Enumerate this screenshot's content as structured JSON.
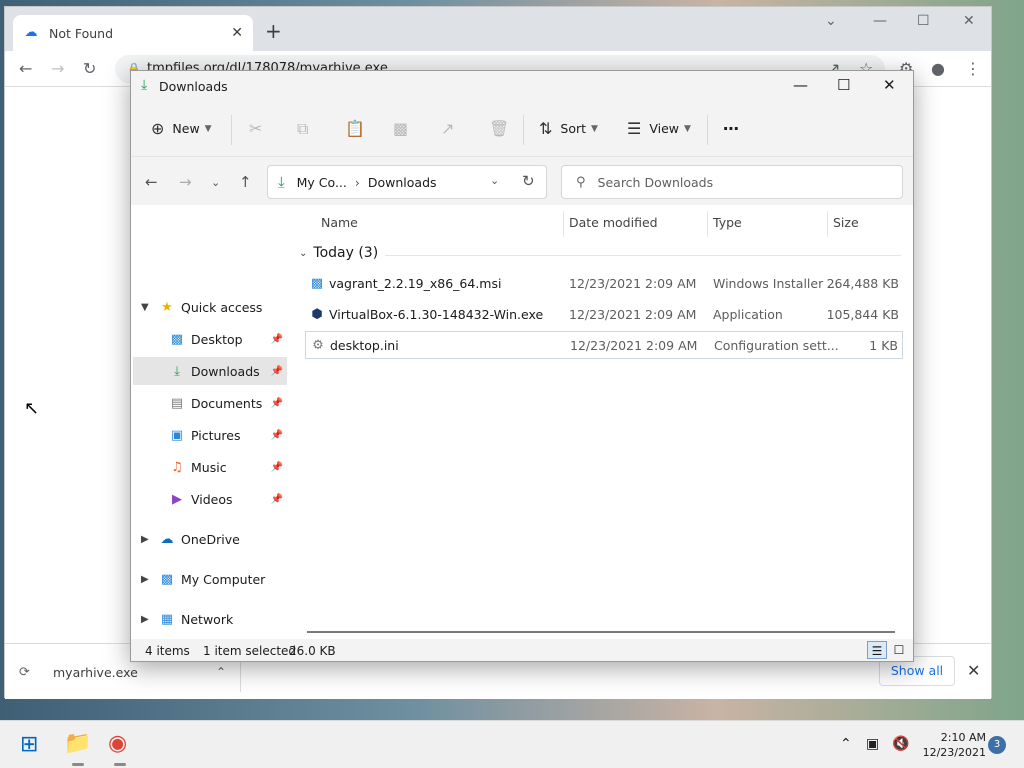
{
  "browser": {
    "tab_title": "Not Found",
    "url": "tmpfiles.org/dl/178078/myarhive.exe",
    "download_filename": "myarhive.exe",
    "show_all_label": "Show all"
  },
  "explorer": {
    "title": "Downloads",
    "toolbar": {
      "new_label": "New",
      "sort_label": "Sort",
      "view_label": "View"
    },
    "breadcrumb": [
      "My Co...",
      "Downloads"
    ],
    "search_placeholder": "Search Downloads",
    "sidebar": {
      "quick_access_label": "Quick access",
      "items": [
        {
          "label": "Desktop",
          "icon": "desktop-icon"
        },
        {
          "label": "Downloads",
          "icon": "download-icon"
        },
        {
          "label": "Documents",
          "icon": "document-icon"
        },
        {
          "label": "Pictures",
          "icon": "picture-icon"
        },
        {
          "label": "Music",
          "icon": "music-icon"
        },
        {
          "label": "Videos",
          "icon": "video-icon"
        }
      ],
      "onedrive_label": "OneDrive",
      "my_computer_label": "My Computer",
      "network_label": "Network"
    },
    "columns": {
      "name": "Name",
      "date": "Date modified",
      "type": "Type",
      "size": "Size"
    },
    "group_label": "Today (3)",
    "files": [
      {
        "name": "vagrant_2.2.19_x86_64.msi",
        "date": "12/23/2021 2:09 AM",
        "type": "Windows Installer ...",
        "size": "264,488 KB",
        "icon": "installer-icon"
      },
      {
        "name": "VirtualBox-6.1.30-148432-Win.exe",
        "date": "12/23/2021 2:09 AM",
        "type": "Application",
        "size": "105,844 KB",
        "icon": "application-icon"
      },
      {
        "name": "desktop.ini",
        "date": "12/23/2021 2:09 AM",
        "type": "Configuration sett...",
        "size": "1 KB",
        "icon": "config-file-icon"
      }
    ],
    "status": {
      "item_count": "4 items",
      "selection": "1 item selected",
      "selection_size": "26.0 KB"
    }
  },
  "taskbar": {
    "time": "2:10 AM",
    "date": "12/23/2021",
    "notification_count": "3"
  },
  "colors": {
    "accent": "#0067c0",
    "download_green": "#1f9d55",
    "chrome_link": "#1a73e8"
  }
}
